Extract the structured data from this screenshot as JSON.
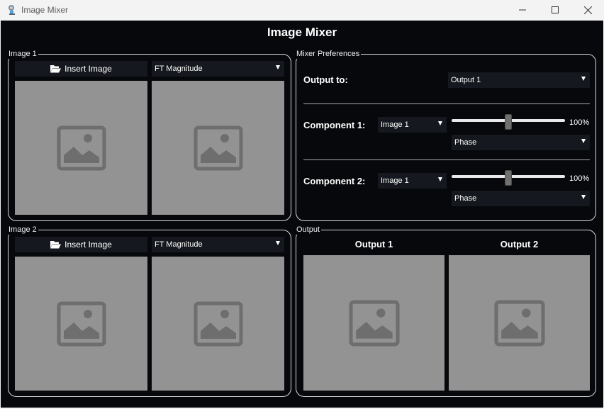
{
  "window": {
    "title": "Image Mixer",
    "icon": "app-icon"
  },
  "header": {
    "title": "Image Mixer"
  },
  "image1": {
    "group_title": "Image 1",
    "insert_label": "Insert Image",
    "component_selected": "FT Magnitude"
  },
  "image2": {
    "group_title": "Image 2",
    "insert_label": "Insert Image",
    "component_selected": "FT Magnitude"
  },
  "mixer": {
    "group_title": "Mixer Preferences",
    "output_to_label": "Output to:",
    "output_to_selected": "Output 1",
    "component1": {
      "label": "Component 1:",
      "image_selected": "Image 1",
      "weight_percent": 100,
      "weight_text": "100%",
      "type_selected": "Phase"
    },
    "component2": {
      "label": "Component 2:",
      "image_selected": "Image 1",
      "weight_percent": 100,
      "weight_text": "100%",
      "type_selected": "Phase"
    }
  },
  "output": {
    "group_title": "Output",
    "output1_title": "Output 1",
    "output2_title": "Output 2"
  },
  "colors": {
    "background": "#06080c",
    "panel_border": "#d9d9d9",
    "image_placeholder": "#939393",
    "placeholder_icon": "#6e6e6e",
    "control_bg": "#15181e"
  }
}
